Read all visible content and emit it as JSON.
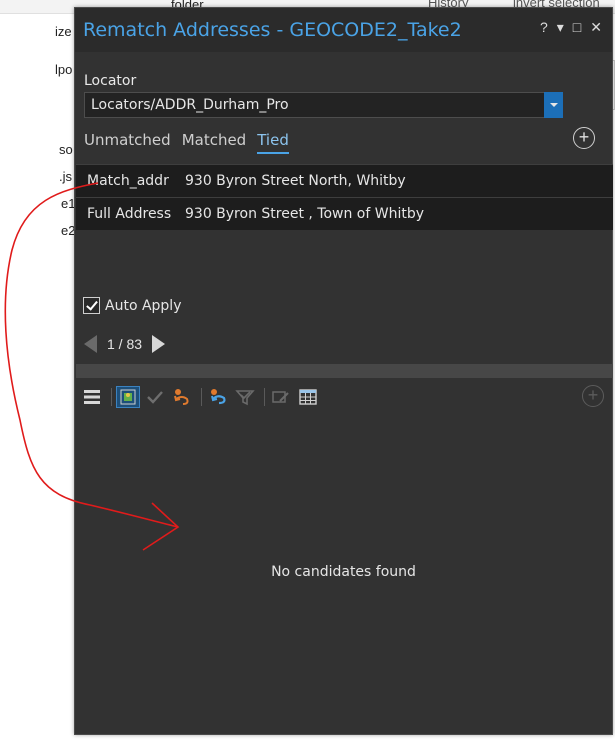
{
  "background": {
    "fragments": [
      "folder",
      "History",
      "invert selection",
      "ize",
      "lpo",
      "so",
      ".js",
      "e1",
      "e2"
    ]
  },
  "pane": {
    "title": "Rematch Addresses - GEOCODE2_Take2",
    "controls": {
      "help": "?",
      "menu": "▾",
      "maximize": "□",
      "close": "✕"
    },
    "locator_label": "Locator",
    "locator_value": "Locators/ADDR_Durham_Pro",
    "tabs": [
      {
        "label": "Unmatched"
      },
      {
        "label": "Matched"
      },
      {
        "label": "Tied"
      }
    ],
    "active_tab": "Tied",
    "fields": [
      {
        "key": "Match_addr",
        "value": "930 Byron Street North, Whitby"
      },
      {
        "key": "Full Address",
        "value": "930  Byron Street , Town of Whitby"
      }
    ],
    "auto_apply_label": "Auto Apply",
    "auto_apply_checked": true,
    "pager_text": "1 / 83",
    "empty_message": "No candidates found",
    "colors": {
      "accent": "#4aa3e6",
      "pane_bg": "#323232",
      "table_bg": "#1d1d1d",
      "annotation": "#e01b1b"
    }
  }
}
